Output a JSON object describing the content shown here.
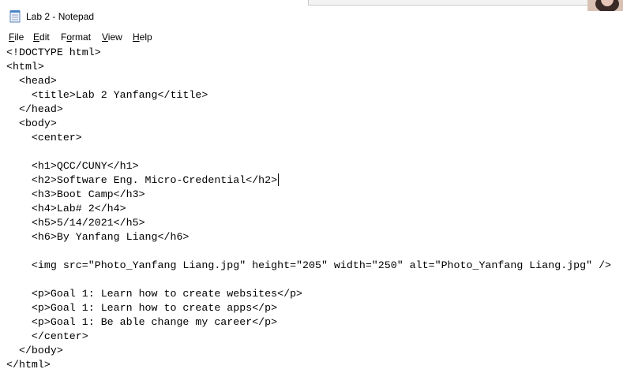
{
  "window": {
    "title": "Lab 2 - Notepad"
  },
  "menu": {
    "items": [
      {
        "mnemonic": "F",
        "rest": "ile"
      },
      {
        "mnemonic": "E",
        "rest": "dit"
      },
      {
        "mnemonic": "",
        "pre": "F",
        "ul": "o",
        "post": "rmat"
      },
      {
        "mnemonic": "V",
        "rest": "iew"
      },
      {
        "mnemonic": "H",
        "rest": "elp"
      }
    ]
  },
  "editor": {
    "lines": [
      "<!DOCTYPE html>",
      "<html>",
      "  <head>",
      "    <title>Lab 2 Yanfang</title>",
      "  </head>",
      "  <body>",
      "    <center>",
      "",
      "    <h1>QCC/CUNY</h1>",
      "    <h2>Software Eng. Micro-Credential</h2>",
      "    <h3>Boot Camp</h3>",
      "    <h4>Lab# 2</h4>",
      "    <h5>5/14/2021</h5>",
      "    <h6>By Yanfang Liang</h6>",
      "",
      "    <img src=\"Photo_Yanfang Liang.jpg\" height=\"205\" width=\"250\" alt=\"Photo_Yanfang Liang.jpg\" />",
      "",
      "    <p>Goal 1: Learn how to create websites</p>",
      "    <p>Goal 1: Learn how to create apps</p>",
      "    <p>Goal 1: Be able change my career</p>",
      "    </center>",
      "  </body>",
      "</html>"
    ]
  },
  "icons": {
    "app_icon": "notepad-icon",
    "avatar": "user-avatar"
  }
}
